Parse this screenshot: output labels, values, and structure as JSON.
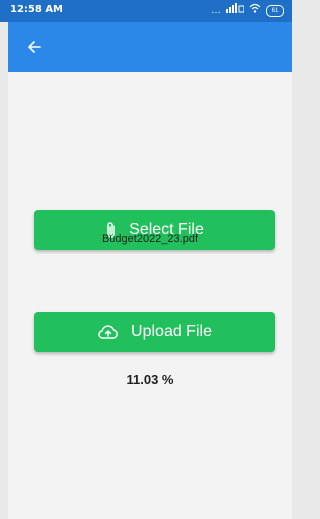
{
  "status_bar": {
    "time": "12:58 AM",
    "signal_text": "…",
    "battery_text": "61"
  },
  "app_bar": {
    "back_icon": "arrow-left-icon",
    "color": "#2b87e8"
  },
  "main": {
    "select_button": {
      "label": "Select File",
      "icon": "paperclip-icon"
    },
    "selected_file_name": "Budget2022_23.pdf",
    "upload_button": {
      "label": "Upload File",
      "icon": "cloud-upload-icon"
    },
    "progress_text": "11.03 %",
    "progress_value": 0.1103,
    "button_color": "#22c05c"
  }
}
